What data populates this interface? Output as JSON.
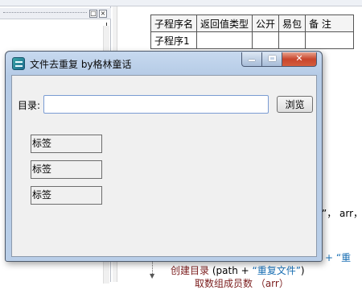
{
  "ide": {
    "table_headers": [
      "子程序名",
      "返回值类型",
      "公开",
      "易包",
      "备 注"
    ],
    "table_row": [
      "子程序1",
      "",
      "",
      "",
      ""
    ],
    "code_fragment_right": "”， arr，",
    "code_fragment_plus": "+ “重",
    "code_line_func": "创建目录",
    "code_line_args_open": " (path + ",
    "code_line_string": "“重复文件”",
    "code_line_close": ")",
    "code_line_partial": "取数组成员数 （arr）",
    "panel_btn_restore": "□",
    "panel_btn_close": "×"
  },
  "dialog": {
    "title": "文件去重复 by格林童话",
    "dir_label": "目录:",
    "dir_value": "",
    "browse_label": "浏览",
    "labels": [
      "标签",
      "标签",
      "标签"
    ],
    "close_glyph": "✕"
  }
}
